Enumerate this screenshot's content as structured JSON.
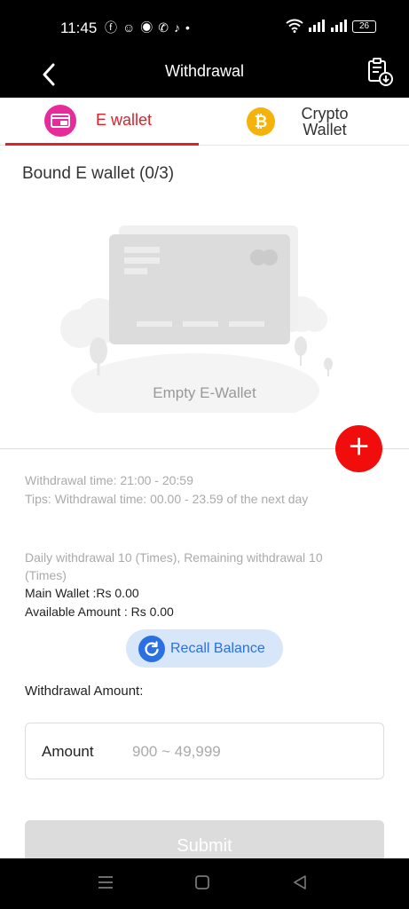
{
  "status_bar": {
    "time": "11:45",
    "app_icons": [
      "facebook-icon",
      "snapchat-icon",
      "messenger-icon",
      "phone-icon",
      "tiktok-icon",
      "dot-icon"
    ],
    "battery": "26"
  },
  "header": {
    "title": "Withdrawal"
  },
  "tabs": [
    {
      "label": "E wallet",
      "active": true
    },
    {
      "label_line1": "Crypto",
      "label_line2": "Wallet",
      "active": false
    }
  ],
  "bound": {
    "title": "Bound E wallet (0/3)",
    "empty_label": "Empty E-Wallet"
  },
  "info": {
    "withdrawal_time": "Withdrawal time:   21:00 - 20:59",
    "tips": "Tips:  Withdrawal time: 00.00 - 23.59 of the next day",
    "daily": "Daily withdrawal 10 (Times), Remaining withdrawal 10 (Times)",
    "main_wallet": "Main Wallet :Rs 0.00",
    "available": "Available Amount : Rs 0.00"
  },
  "recall_label": "Recall Balance",
  "withdrawal_amount_label": "Withdrawal Amount:",
  "amount": {
    "label": "Amount",
    "placeholder": "900 ~ 49,999",
    "value": ""
  },
  "submit_label": "Submit",
  "colors": {
    "accent_red": "#e0202a",
    "add_button": "#f20d0d",
    "ewallet_icon": "#e82b9a",
    "crypto_icon": "#f5b20a",
    "recall_blue": "#2a70e0"
  }
}
